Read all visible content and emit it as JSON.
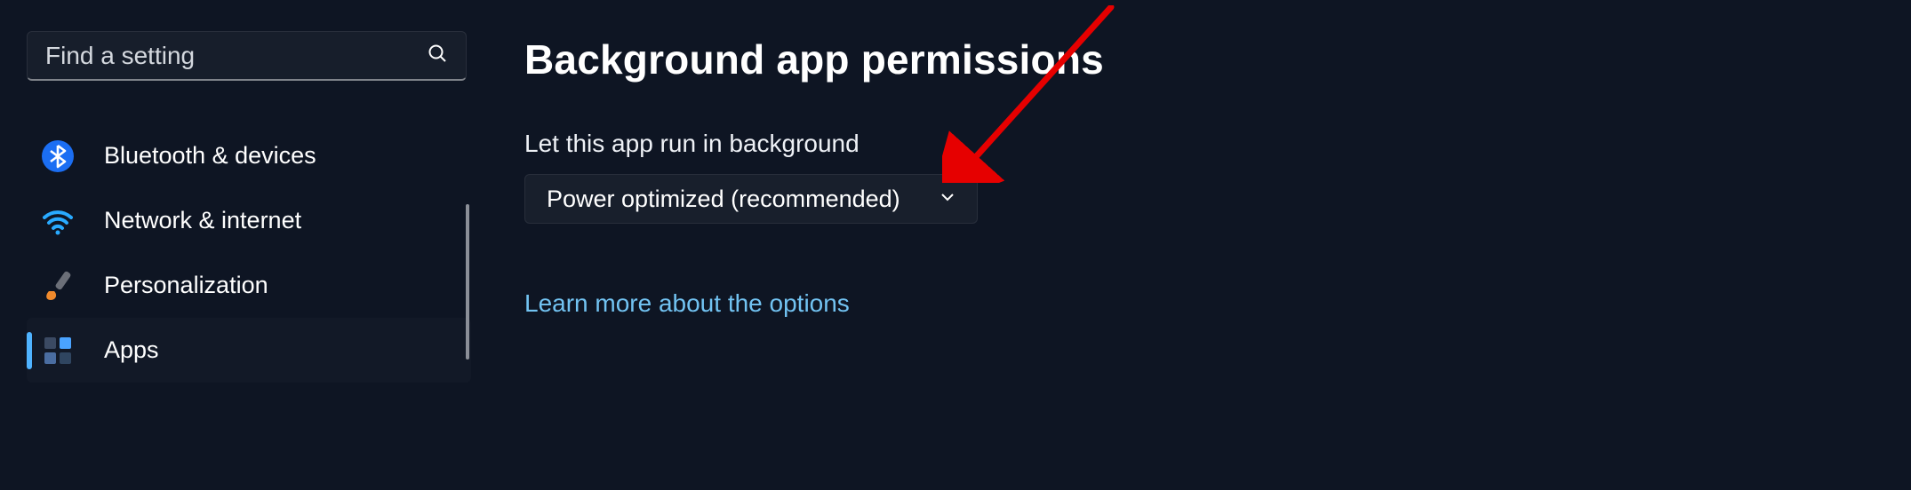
{
  "search": {
    "placeholder": "Find a setting"
  },
  "sidebar": {
    "items": [
      {
        "label": "Bluetooth & devices",
        "icon": "bluetooth"
      },
      {
        "label": "Network & internet",
        "icon": "wifi"
      },
      {
        "label": "Personalization",
        "icon": "brush"
      },
      {
        "label": "Apps",
        "icon": "apps",
        "active": true
      }
    ]
  },
  "main": {
    "title": "Background app permissions",
    "option_label": "Let this app run in background",
    "dropdown_value": "Power optimized (recommended)",
    "learn_more": "Learn more about the options"
  },
  "annotation": {
    "type": "arrow",
    "color": "#e60000"
  }
}
